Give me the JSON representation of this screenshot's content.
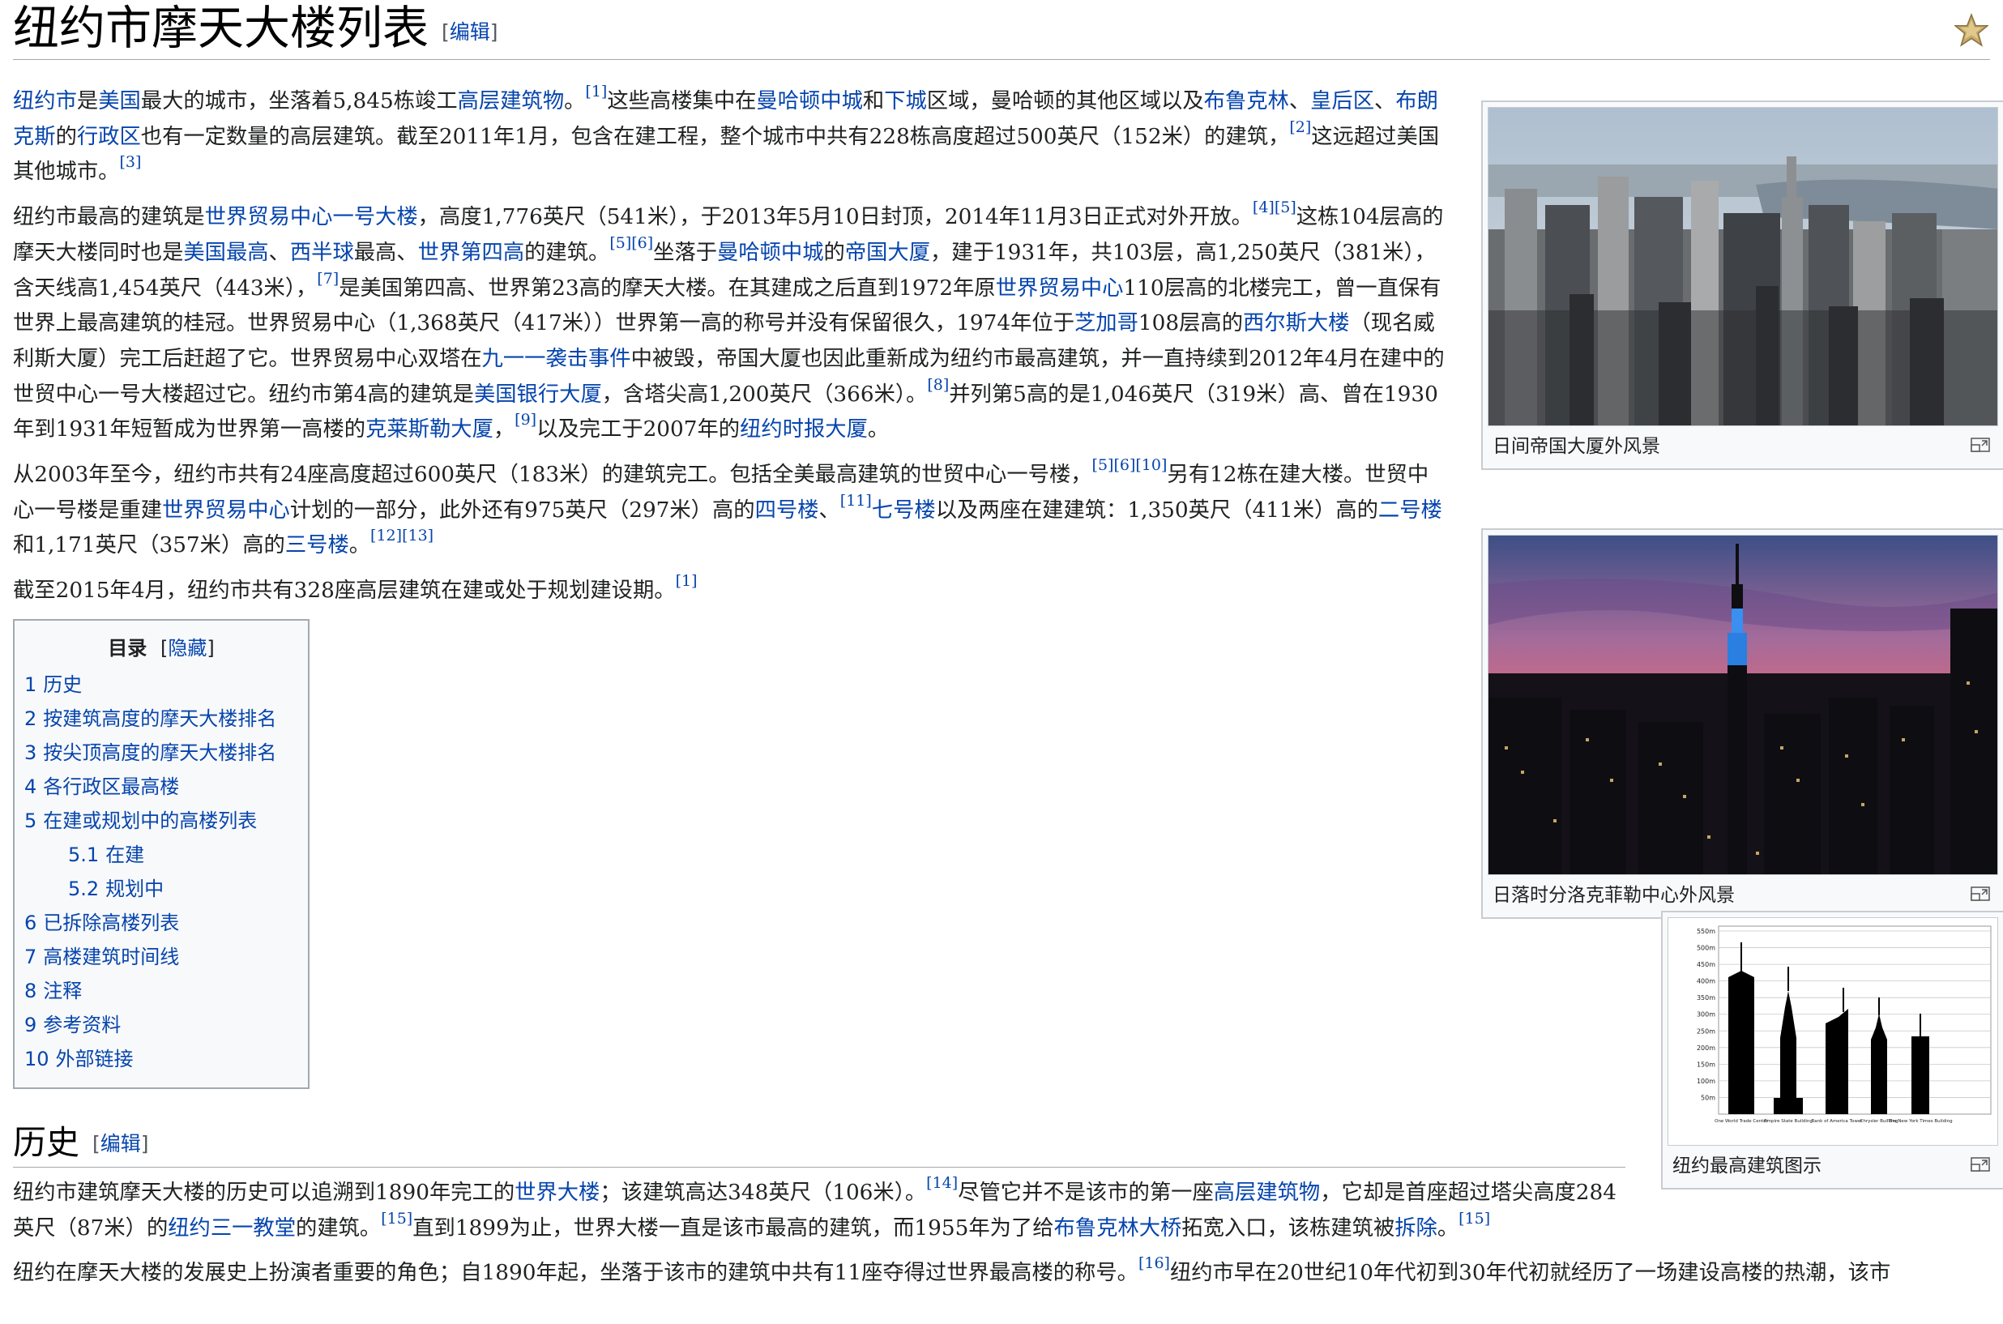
{
  "page": {
    "title": "纽约市摩天大楼列表",
    "edit_label": "编辑",
    "star_icon": "star-icon"
  },
  "intro": {
    "p1": {
      "l_nyc": "纽约市",
      "t1": "是",
      "l_us": "美国",
      "t2": "最大的城市，坐落着5,845栋竣工",
      "l_highrise": "高层建筑物",
      "t3": "。",
      "r1": "[1]",
      "t4": "这些高楼集中在",
      "l_midtown": "曼哈顿中城",
      "t5": "和",
      "l_downtown": "下城",
      "t6": "区域，曼哈顿的其他区域以及",
      "l_brooklyn": "布鲁克林",
      "t7": "、",
      "l_queens": "皇后区",
      "t8": "、",
      "l_bronx": "布朗克斯",
      "t9": "的",
      "l_borough": "行政区",
      "t10": "也有一定数量的高层建筑。截至2011年1月，包含在建工程，整个城市中共有228栋高度超过500英尺（152米）的建筑，",
      "r2": "[2]",
      "t11": "这远超过美国其他城市。",
      "r3": "[3]"
    },
    "p2": {
      "t1": "纽约市最高的建筑是",
      "l_1wtc": "世界贸易中心一号大楼",
      "t2": "，高度1,776英尺（541米），于2013年5月10日封顶，2014年11月3日正式对外开放。",
      "r4": "[4]",
      "r5": "[5]",
      "t3": "这栋104层高的摩天大楼同时也是",
      "l_ustallest": "美国最高",
      "t4": "、",
      "l_western": "西半球",
      "t5": "最高、",
      "l_world4": "世界第四高",
      "t6": "的建筑。",
      "r5b": "[5]",
      "r6": "[6]",
      "t7": "坐落于",
      "l_midtown": "曼哈顿中城",
      "t8": "的",
      "l_esb": "帝国大厦",
      "t9": "，建于1931年，共103层，高1,250英尺（381米），含天线高1,454英尺（443米），",
      "r7": "[7]",
      "t10": "是美国第四高、世界第23高的摩天大楼。在其建成之后直到1972年原",
      "l_wtc": "世界贸易中心",
      "t11": "110层高的北楼完工，曾一直保有世界上最高建筑的桂冠。世界贸易中心（1,368英尺（417米））世界第一高的称号并没有保留很久，1974年位于",
      "l_chicago": "芝加哥",
      "t12": "108层高的",
      "l_sears": "西尔斯大楼",
      "t13": "（现名威利斯大厦）完工后赶超了它。世界贸易中心双塔在",
      "l_911": "九一一袭击事件",
      "t14": "中被毁，帝国大厦也因此重新成为纽约市最高建筑，并一直持续到2012年4月在建中的世贸中心一号大楼超过它。纽约市第4高的建筑是",
      "l_boa": "美国银行大厦",
      "t15": "，含塔尖高1,200英尺（366米）。",
      "r8": "[8]",
      "t16": "并列第5高的是1,046英尺（319米）高、曾在1930年到1931年短暂成为世界第一高楼的",
      "l_chrysler": "克莱斯勒大厦",
      "t17": "，",
      "r9": "[9]",
      "t18": "以及完工于2007年的",
      "l_nyt": "纽约时报大厦",
      "t19": "。"
    },
    "p3": {
      "t1": "从2003年至今，纽约市共有24座高度超过600英尺（183米）的建筑完工。包括全美最高建筑的世贸中心一号楼，",
      "r5": "[5]",
      "r6": "[6]",
      "r10": "[10]",
      "t2": "另有12栋在建大楼。世贸中心一号楼是重建",
      "l_wtc": "世界贸易中心",
      "t3": "计划的一部分，此外还有975英尺（297米）高的",
      "l_4wtc": "四号楼",
      "t4": "、",
      "r11": "[11]",
      "l_7wtc": "七号楼",
      "t5": "以及两座在建建筑：1,350英尺（411米）高的",
      "l_2wtc": "二号楼",
      "t6": "和1,171英尺（357米）高的",
      "l_3wtc": "三号楼",
      "t7": "。",
      "r12": "[12]",
      "r13": "[13]"
    },
    "p4": {
      "t1": "截至2015年4月，纽约市共有328座高层建筑在建或处于规划建设期。",
      "r1": "[1]"
    }
  },
  "toc": {
    "title": "目录",
    "toggle": "隐藏",
    "items": [
      {
        "num": "1",
        "label": "历史"
      },
      {
        "num": "2",
        "label": "按建筑高度的摩天大楼排名"
      },
      {
        "num": "3",
        "label": "按尖顶高度的摩天大楼排名"
      },
      {
        "num": "4",
        "label": "各行政区最高楼"
      },
      {
        "num": "5",
        "label": "在建或规划中的高楼列表"
      },
      {
        "num": "5.1",
        "label": "在建"
      },
      {
        "num": "5.2",
        "label": "规划中"
      },
      {
        "num": "6",
        "label": "已拆除高楼列表"
      },
      {
        "num": "7",
        "label": "高楼建筑时间线"
      },
      {
        "num": "8",
        "label": "注释"
      },
      {
        "num": "9",
        "label": "参考资料"
      },
      {
        "num": "10",
        "label": "外部链接"
      }
    ]
  },
  "thumbs": {
    "t1_caption": "日间帝国大厦外风景",
    "t2_caption": "日落时分洛克菲勒中心外风景",
    "t3_caption": "纽约最高建筑图示",
    "enlarge_icon": "magnify-clip-icon"
  },
  "chart": {
    "yticks": [
      "550m",
      "500m",
      "450m",
      "400m",
      "350m",
      "300m",
      "250m",
      "200m",
      "150m",
      "100m",
      "50m"
    ],
    "buildings": [
      "One World Trade Center",
      "Empire State Building",
      "Bank of America Tower",
      "Chrysler Building",
      "The New York Times Building"
    ]
  },
  "history": {
    "heading": "历史",
    "p1": {
      "t1": "纽约市建筑摩天大楼的历史可以追溯到1890年完工的",
      "l_world": "世界大楼",
      "t2": "；该建筑高达348英尺（106米）。",
      "r14": "[14]",
      "t3": "尽管它并不是该市的第一座",
      "l_highrise": "高层建筑物",
      "t4": "，它却是首座超过塔尖高度284英尺（87米）的",
      "l_trinity": "纽约三一教堂",
      "t5": "的建筑。",
      "r15": "[15]",
      "t6": "直到1899为止，世界大楼一直是该市最高的建筑，而1955年为了给",
      "l_bridge": "布鲁克林大桥",
      "t7": "拓宽入口，该栋建筑被",
      "l_demolish": "拆除",
      "t8": "。",
      "r15b": "[15]"
    },
    "p2": {
      "t1": "纽约在摩天大楼的发展史上扮演者重要的角色；自1890年起，坐落于该市的建筑中共有11座夺得过世界最高楼的称号。",
      "r16": "[16]",
      "t2": "纽约市早在20世纪10年代初到30年代初就经历了一场建设高楼的热潮，该市"
    }
  }
}
